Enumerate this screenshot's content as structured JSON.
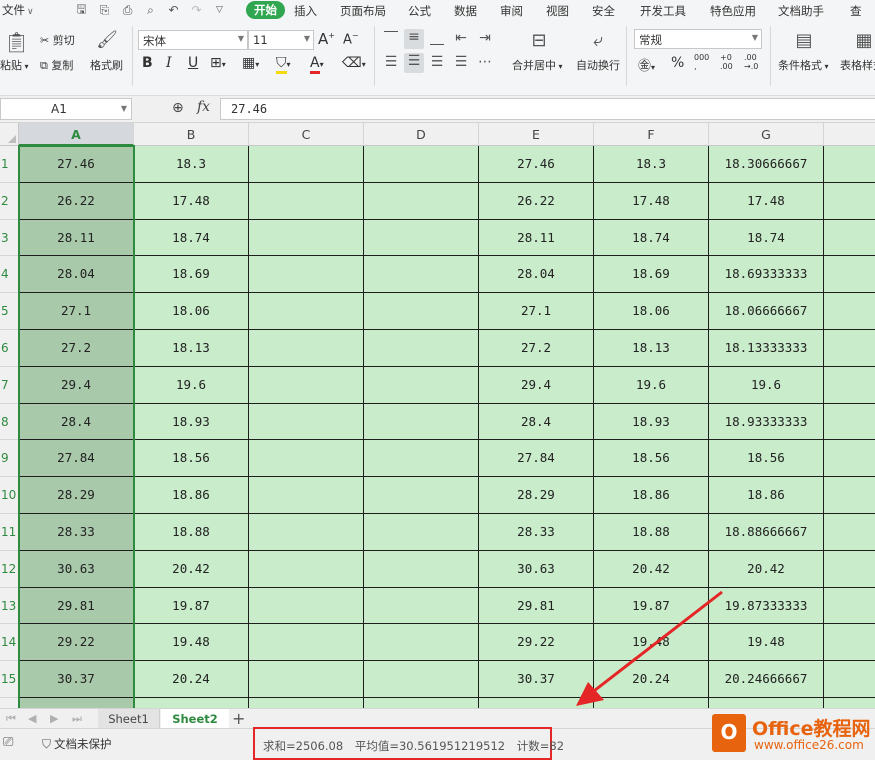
{
  "menubar": {
    "file": "文件",
    "tabs": [
      "开始",
      "插入",
      "页面布局",
      "公式",
      "数据",
      "审阅",
      "视图",
      "安全",
      "开发工具",
      "特色应用",
      "文档助手",
      "查"
    ],
    "active_tab": "开始"
  },
  "ribbon": {
    "paste": "粘贴",
    "cut": "剪切",
    "copy": "复制",
    "format_painter": "格式刷",
    "font_name": "宋体",
    "font_size": "11",
    "merge_center": "合并居中",
    "wrap_text": "自动换行",
    "number_format": "常规",
    "conditional_format": "条件格式",
    "table_style": "表格样式"
  },
  "formula_bar": {
    "cell_ref": "A1",
    "fx": "fx",
    "value": "27.46"
  },
  "grid": {
    "columns": [
      "A",
      "B",
      "C",
      "D",
      "E",
      "F",
      "G"
    ],
    "selected_column": "A",
    "rows": [
      {
        "n": "1",
        "A": "27.46",
        "B": "18.3",
        "C": "",
        "D": "",
        "E": "27.46",
        "F": "18.3",
        "G": "18.30666667"
      },
      {
        "n": "2",
        "A": "26.22",
        "B": "17.48",
        "C": "",
        "D": "",
        "E": "26.22",
        "F": "17.48",
        "G": "17.48"
      },
      {
        "n": "3",
        "A": "28.11",
        "B": "18.74",
        "C": "",
        "D": "",
        "E": "28.11",
        "F": "18.74",
        "G": "18.74"
      },
      {
        "n": "4",
        "A": "28.04",
        "B": "18.69",
        "C": "",
        "D": "",
        "E": "28.04",
        "F": "18.69",
        "G": "18.69333333"
      },
      {
        "n": "5",
        "A": "27.1",
        "B": "18.06",
        "C": "",
        "D": "",
        "E": "27.1",
        "F": "18.06",
        "G": "18.06666667"
      },
      {
        "n": "6",
        "A": "27.2",
        "B": "18.13",
        "C": "",
        "D": "",
        "E": "27.2",
        "F": "18.13",
        "G": "18.13333333"
      },
      {
        "n": "7",
        "A": "29.4",
        "B": "19.6",
        "C": "",
        "D": "",
        "E": "29.4",
        "F": "19.6",
        "G": "19.6"
      },
      {
        "n": "8",
        "A": "28.4",
        "B": "18.93",
        "C": "",
        "D": "",
        "E": "28.4",
        "F": "18.93",
        "G": "18.93333333"
      },
      {
        "n": "9",
        "A": "27.84",
        "B": "18.56",
        "C": "",
        "D": "",
        "E": "27.84",
        "F": "18.56",
        "G": "18.56"
      },
      {
        "n": "10",
        "A": "28.29",
        "B": "18.86",
        "C": "",
        "D": "",
        "E": "28.29",
        "F": "18.86",
        "G": "18.86"
      },
      {
        "n": "11",
        "A": "28.33",
        "B": "18.88",
        "C": "",
        "D": "",
        "E": "28.33",
        "F": "18.88",
        "G": "18.88666667"
      },
      {
        "n": "12",
        "A": "30.63",
        "B": "20.42",
        "C": "",
        "D": "",
        "E": "30.63",
        "F": "20.42",
        "G": "20.42"
      },
      {
        "n": "13",
        "A": "29.81",
        "B": "19.87",
        "C": "",
        "D": "",
        "E": "29.81",
        "F": "19.87",
        "G": "19.87333333"
      },
      {
        "n": "14",
        "A": "29.22",
        "B": "19.48",
        "C": "",
        "D": "",
        "E": "29.22",
        "F": "19.48",
        "G": "19.48"
      },
      {
        "n": "15",
        "A": "30.37",
        "B": "20.24",
        "C": "",
        "D": "",
        "E": "30.37",
        "F": "20.24",
        "G": "20.24666667"
      }
    ]
  },
  "sheets": {
    "tabs": [
      "Sheet1",
      "Sheet2"
    ],
    "active": "Sheet2"
  },
  "statusbar": {
    "protect": "文档未保护",
    "sum": "求和=2506.08",
    "average": "平均值=30.561951219512",
    "count": "计数=82"
  },
  "watermark": {
    "logo_letter": "O",
    "title": "Office教程网",
    "url": "www.office26.com"
  },
  "colors": {
    "accent_green": "#2d8a3e",
    "cell_fill": "#c9eccb",
    "selected_fill": "#a9c9ab",
    "highlight_red": "#e52626",
    "watermark_orange": "#e8630e"
  }
}
